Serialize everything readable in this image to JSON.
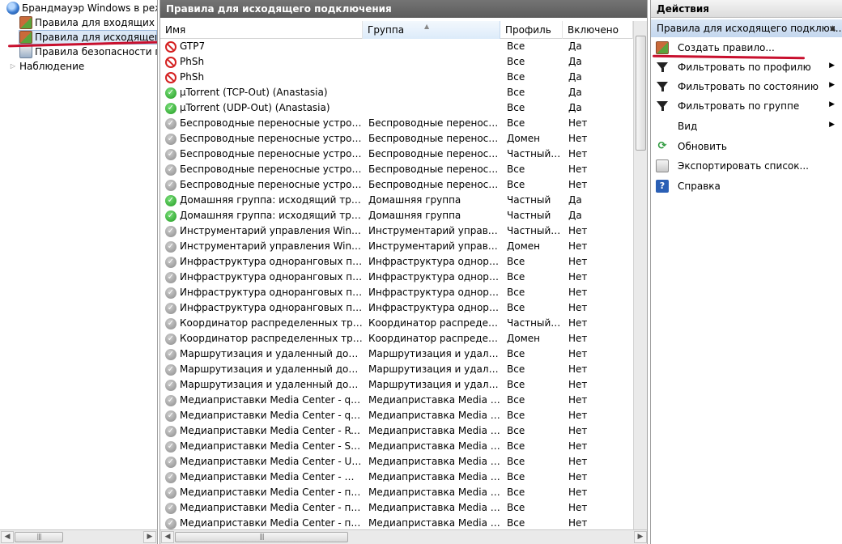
{
  "tree": {
    "root_label": "Брандмауэр Windows в режим",
    "items": [
      {
        "label": "Правила для входящих под",
        "icon": "firewall-brick-icon"
      },
      {
        "label": "Правила для исходящего п",
        "icon": "firewall-brick-icon",
        "selected": true
      },
      {
        "label": "Правила безопасности под",
        "icon": "security-rules-icon"
      },
      {
        "label": "Наблюдение",
        "icon": "monitor-icon"
      }
    ]
  },
  "center": {
    "title": "Правила для исходящего подключения",
    "columns": [
      "Имя",
      "Группа",
      "Профиль",
      "Включено"
    ],
    "rows": [
      {
        "status": "block",
        "name": "GTP7",
        "group": "",
        "profile": "Все",
        "enabled": "Да"
      },
      {
        "status": "block",
        "name": "PhSh",
        "group": "",
        "profile": "Все",
        "enabled": "Да"
      },
      {
        "status": "block",
        "name": "PhSh",
        "group": "",
        "profile": "Все",
        "enabled": "Да"
      },
      {
        "status": "allow",
        "name": "µTorrent (TCP-Out) (Anastasia)",
        "group": "",
        "profile": "Все",
        "enabled": "Да"
      },
      {
        "status": "allow",
        "name": "µTorrent (UDP-Out) (Anastasia)",
        "group": "",
        "profile": "Все",
        "enabled": "Да"
      },
      {
        "status": "disabled",
        "name": "Беспроводные переносные устройства...",
        "group": "Беспроводные переносны...",
        "profile": "Все",
        "enabled": "Нет"
      },
      {
        "status": "disabled",
        "name": "Беспроводные переносные устройства...",
        "group": "Беспроводные переносны...",
        "profile": "Домен",
        "enabled": "Нет"
      },
      {
        "status": "disabled",
        "name": "Беспроводные переносные устройства...",
        "group": "Беспроводные переносны...",
        "profile": "Частный, ...",
        "enabled": "Нет"
      },
      {
        "status": "disabled",
        "name": "Беспроводные переносные устройства...",
        "group": "Беспроводные переносны...",
        "profile": "Все",
        "enabled": "Нет"
      },
      {
        "status": "disabled",
        "name": "Беспроводные переносные устройства...",
        "group": "Беспроводные переносны...",
        "profile": "Все",
        "enabled": "Нет"
      },
      {
        "status": "allow",
        "name": "Домашняя группа: исходящий трафик ...",
        "group": "Домашняя группа",
        "profile": "Частный",
        "enabled": "Да"
      },
      {
        "status": "allow",
        "name": "Домашняя группа: исходящий трафик ...",
        "group": "Домашняя группа",
        "profile": "Частный",
        "enabled": "Да"
      },
      {
        "status": "disabled",
        "name": "Инструментарий управления Windows ...",
        "group": "Инструментарий управлен...",
        "profile": "Частный, ...",
        "enabled": "Нет"
      },
      {
        "status": "disabled",
        "name": "Инструментарий управления Windows ...",
        "group": "Инструментарий управлен...",
        "profile": "Домен",
        "enabled": "Нет"
      },
      {
        "status": "disabled",
        "name": "Инфраструктура одноранговых подкл...",
        "group": "Инфраструктура одноранг...",
        "profile": "Все",
        "enabled": "Нет"
      },
      {
        "status": "disabled",
        "name": "Инфраструктура одноранговых подкл...",
        "group": "Инфраструктура одноранг...",
        "profile": "Все",
        "enabled": "Нет"
      },
      {
        "status": "disabled",
        "name": "Инфраструктура одноранговых подкл...",
        "group": "Инфраструктура одноранг...",
        "profile": "Все",
        "enabled": "Нет"
      },
      {
        "status": "disabled",
        "name": "Инфраструктура одноранговых подкл...",
        "group": "Инфраструктура одноранг...",
        "profile": "Все",
        "enabled": "Нет"
      },
      {
        "status": "disabled",
        "name": "Координатор распределенных транзак...",
        "group": "Координатор распределен...",
        "profile": "Частный, ...",
        "enabled": "Нет"
      },
      {
        "status": "disabled",
        "name": "Координатор распределенных транзак...",
        "group": "Координатор распределен...",
        "profile": "Домен",
        "enabled": "Нет"
      },
      {
        "status": "disabled",
        "name": "Маршрутизация и удаленный доступ (...",
        "group": "Маршрутизация и удаленн...",
        "profile": "Все",
        "enabled": "Нет"
      },
      {
        "status": "disabled",
        "name": "Маршрутизация и удаленный доступ (...",
        "group": "Маршрутизация и удаленн...",
        "profile": "Все",
        "enabled": "Нет"
      },
      {
        "status": "disabled",
        "name": "Маршрутизация и удаленный доступ (...",
        "group": "Маршрутизация и удаленн...",
        "profile": "Все",
        "enabled": "Нет"
      },
      {
        "status": "disabled",
        "name": "Медиаприставки Media Center - qWave ...",
        "group": "Медиаприставка Media Ce...",
        "profile": "Все",
        "enabled": "Нет"
      },
      {
        "status": "disabled",
        "name": "Медиаприставки Media Center - qWave ...",
        "group": "Медиаприставка Media Ce...",
        "profile": "Все",
        "enabled": "Нет"
      },
      {
        "status": "disabled",
        "name": "Медиаприставки Media Center - RTSP ...",
        "group": "Медиаприставка Media Ce...",
        "profile": "Все",
        "enabled": "Нет"
      },
      {
        "status": "disabled",
        "name": "Медиаприставки Media Center - SSDP ...",
        "group": "Медиаприставка Media Ce...",
        "profile": "Все",
        "enabled": "Нет"
      },
      {
        "status": "disabled",
        "name": "Медиаприставки Media Center - UPnP ...",
        "group": "Медиаприставка Media Ce...",
        "profile": "Все",
        "enabled": "Нет"
      },
      {
        "status": "disabled",
        "name": "Медиаприставки Media Center - WMDR...",
        "group": "Медиаприставка Media Ce...",
        "profile": "Все",
        "enabled": "Нет"
      },
      {
        "status": "disabled",
        "name": "Медиаприставки Media Center - подгот...",
        "group": "Медиаприставка Media Ce...",
        "profile": "Все",
        "enabled": "Нет"
      },
      {
        "status": "disabled",
        "name": "Медиаприставки Media Center - потоко...",
        "group": "Медиаприставка Media Ce...",
        "profile": "Все",
        "enabled": "Нет"
      },
      {
        "status": "disabled",
        "name": "Медиаприставки Media Center - потоко...",
        "group": "Медиаприставка Media Ce...",
        "profile": "Все",
        "enabled": "Нет"
      }
    ]
  },
  "actions": {
    "title": "Действия",
    "section": "Правила для исходящего подключ...",
    "items": [
      {
        "label": "Создать правило...",
        "icon": "new-rule-icon"
      },
      {
        "label": "Фильтровать по профилю",
        "icon": "filter-icon",
        "submenu": true
      },
      {
        "label": "Фильтровать по состоянию",
        "icon": "filter-icon",
        "submenu": true
      },
      {
        "label": "Фильтровать по группе",
        "icon": "filter-icon",
        "submenu": true
      },
      {
        "label": "Вид",
        "icon": "",
        "submenu": true
      },
      {
        "label": "Обновить",
        "icon": "refresh-icon"
      },
      {
        "label": "Экспортировать список...",
        "icon": "export-icon"
      },
      {
        "label": "Справка",
        "icon": "help-icon"
      }
    ]
  },
  "colors": {
    "title_bar": "#5c5c5c",
    "selection": "#dbe7f5",
    "annotation_red": "#c8102e",
    "allow_green": "#1e9a1e",
    "block_red": "#d42121",
    "disabled_gray": "#8a8a8a"
  }
}
